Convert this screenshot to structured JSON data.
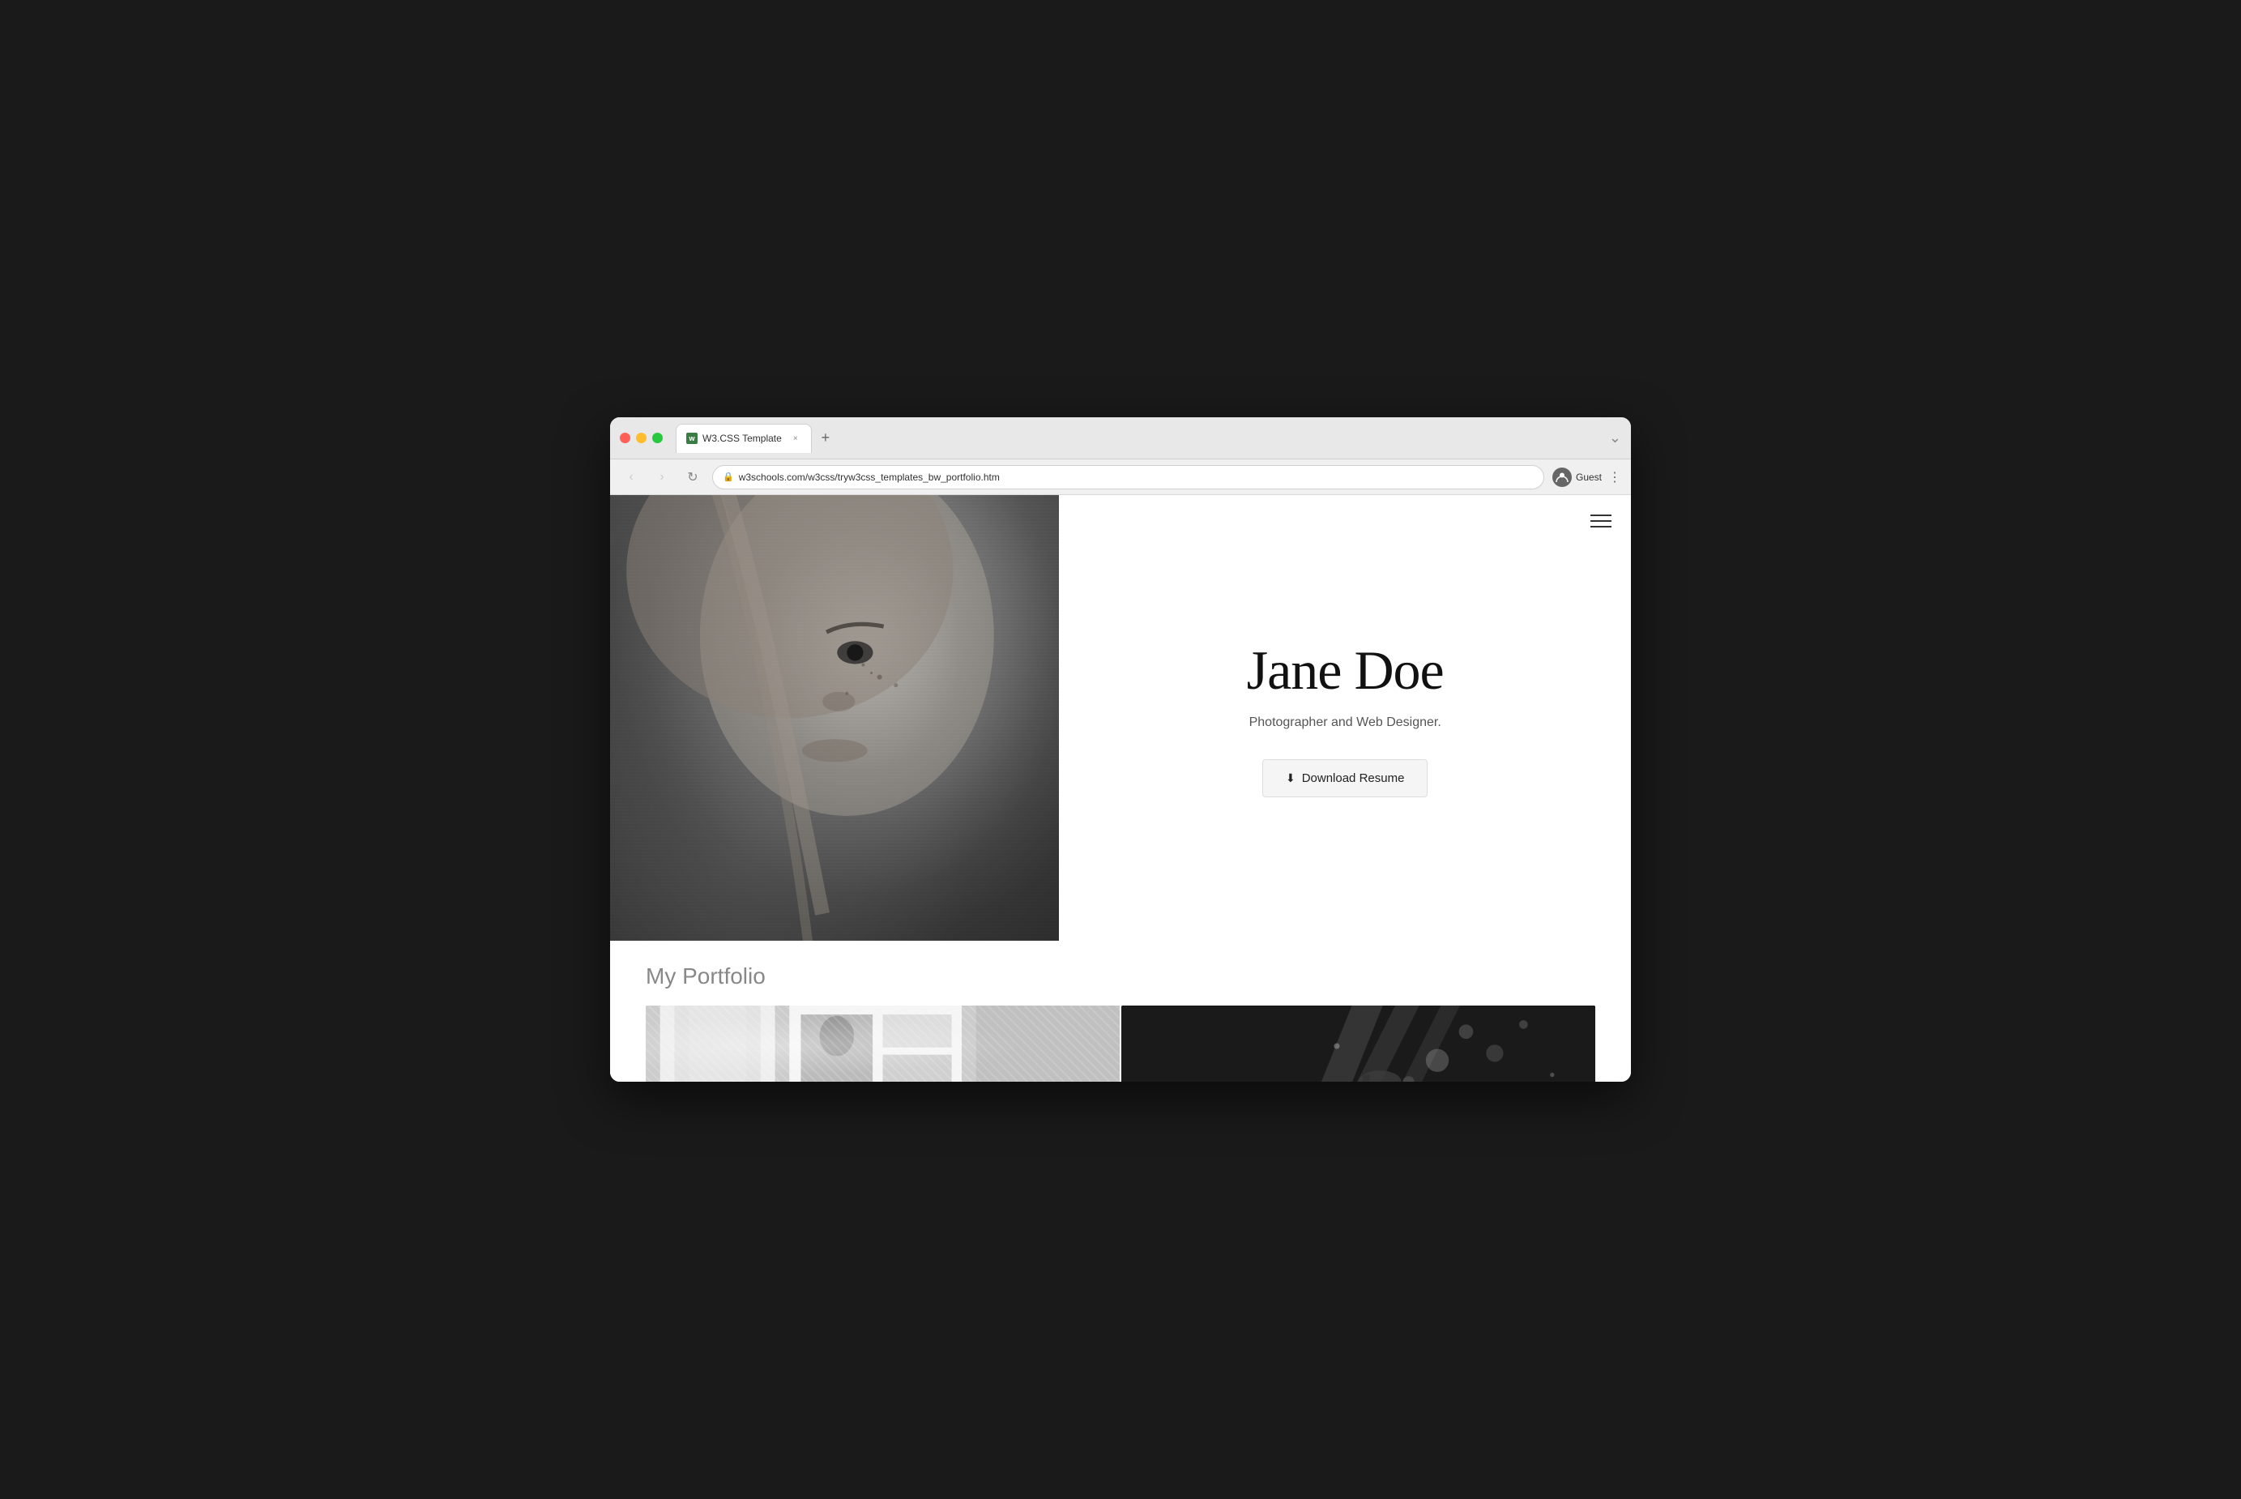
{
  "browser": {
    "tab_label": "W3.CSS Template",
    "tab_close": "×",
    "tab_new": "+",
    "url": "w3schools.com/w3css/tryw3css_templates_bw_portfolio.htm",
    "favicon_label": "w",
    "user_label": "Guest",
    "chevron": "⌄",
    "back_arrow": "‹",
    "forward_arrow": "›",
    "refresh": "↻",
    "lock": "🔒",
    "more_options": "⋮"
  },
  "site": {
    "hero": {
      "name": "Jane Doe",
      "subtitle": "Photographer and Web Designer.",
      "download_btn": "Download Resume"
    },
    "portfolio": {
      "title": "My Portfolio"
    }
  },
  "colors": {
    "accent_green": "#28c840",
    "accent_yellow": "#febc2e",
    "accent_red": "#ff5f57"
  }
}
